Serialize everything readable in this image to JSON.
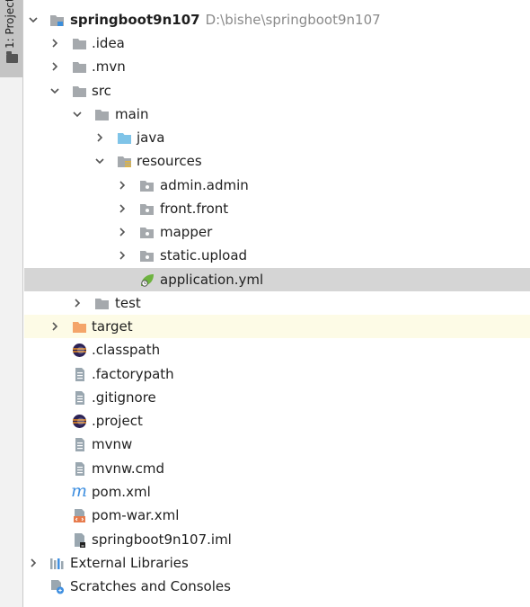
{
  "sidebar": {
    "tab_label": "1: Project"
  },
  "tree": {
    "root": {
      "name": "springboot9n107",
      "path": "D:\\bishe\\springboot9n107"
    },
    "items": [
      {
        "label": ".idea"
      },
      {
        "label": ".mvn"
      },
      {
        "label": "src"
      },
      {
        "label": "main"
      },
      {
        "label": "java"
      },
      {
        "label": "resources"
      },
      {
        "label": "admin.admin"
      },
      {
        "label": "front.front"
      },
      {
        "label": "mapper"
      },
      {
        "label": "static.upload"
      },
      {
        "label": "application.yml"
      },
      {
        "label": "test"
      },
      {
        "label": "target"
      },
      {
        "label": ".classpath"
      },
      {
        "label": ".factorypath"
      },
      {
        "label": ".gitignore"
      },
      {
        "label": ".project"
      },
      {
        "label": "mvnw"
      },
      {
        "label": "mvnw.cmd"
      },
      {
        "label": "pom.xml"
      },
      {
        "label": "pom-war.xml"
      },
      {
        "label": "springboot9n107.iml"
      },
      {
        "label": "External Libraries"
      },
      {
        "label": "Scratches and Consoles"
      }
    ]
  },
  "colors": {
    "selected_row": "#d5d5d5",
    "target_row": "#fdfbe6",
    "folder_gray": "#a5a9ad",
    "folder_blue": "#7fc4e8",
    "folder_orange": "#f4a56a",
    "spring_green": "#6db33f"
  }
}
